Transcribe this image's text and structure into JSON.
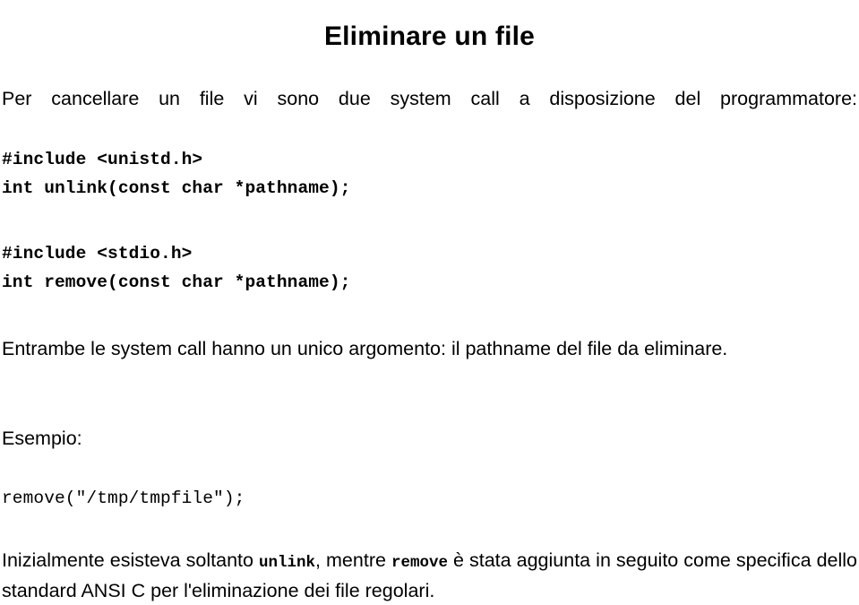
{
  "slide": {
    "title": "Eliminare un file",
    "intro_paragraph": "Per cancellare un file vi sono due system call a disposizione del programmatore:",
    "code_block_unistd": "#include <unistd.h>\nint unlink(const char *pathname);",
    "code_block_stdio": "#include <stdio.h>\nint remove(const char *pathname);",
    "arguments_paragraph": "Entrambe le system call hanno un unico argomento: il pathname del file da eliminare.",
    "esempio_label": "Esempio:",
    "code_example": "remove(\"/tmp/tmpfile\");",
    "history_paragraph": {
      "part1": "Inizialmente esisteva soltanto ",
      "code1": "unlink",
      "part2": ", mentre ",
      "code2": "remove",
      "part3": " è stata aggiunta in seguito come specifica dello standard ANSI C per l'eliminazione dei file regolari."
    }
  },
  "colors": {
    "background": "#ffffff",
    "text": "#000000"
  }
}
